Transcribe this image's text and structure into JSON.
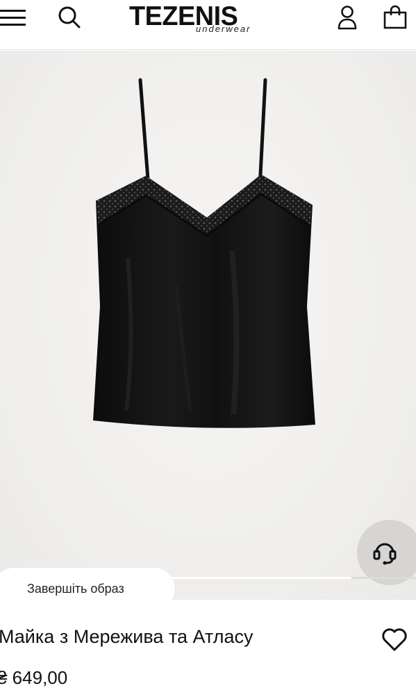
{
  "header": {
    "logo_brand": "TEZENIS",
    "logo_sub": "underwear",
    "icons": [
      "menu-icon",
      "search-icon",
      "user-icon",
      "shopping-bag-icon"
    ]
  },
  "product": {
    "image_alt": "Майка з Мережива та Атласу",
    "title": "Майка з Мережива та Атласу",
    "price": "₴ 649,00",
    "gallery_progress": 0.845
  },
  "overlay": {
    "complete_look_label": "Завершіть образ",
    "support_icon": "headset-icon",
    "favorite_icon": "heart-icon"
  },
  "colors": {
    "hero_background": "#f1f0ee",
    "support_button": "#d6d5d3",
    "text": "#111111"
  }
}
